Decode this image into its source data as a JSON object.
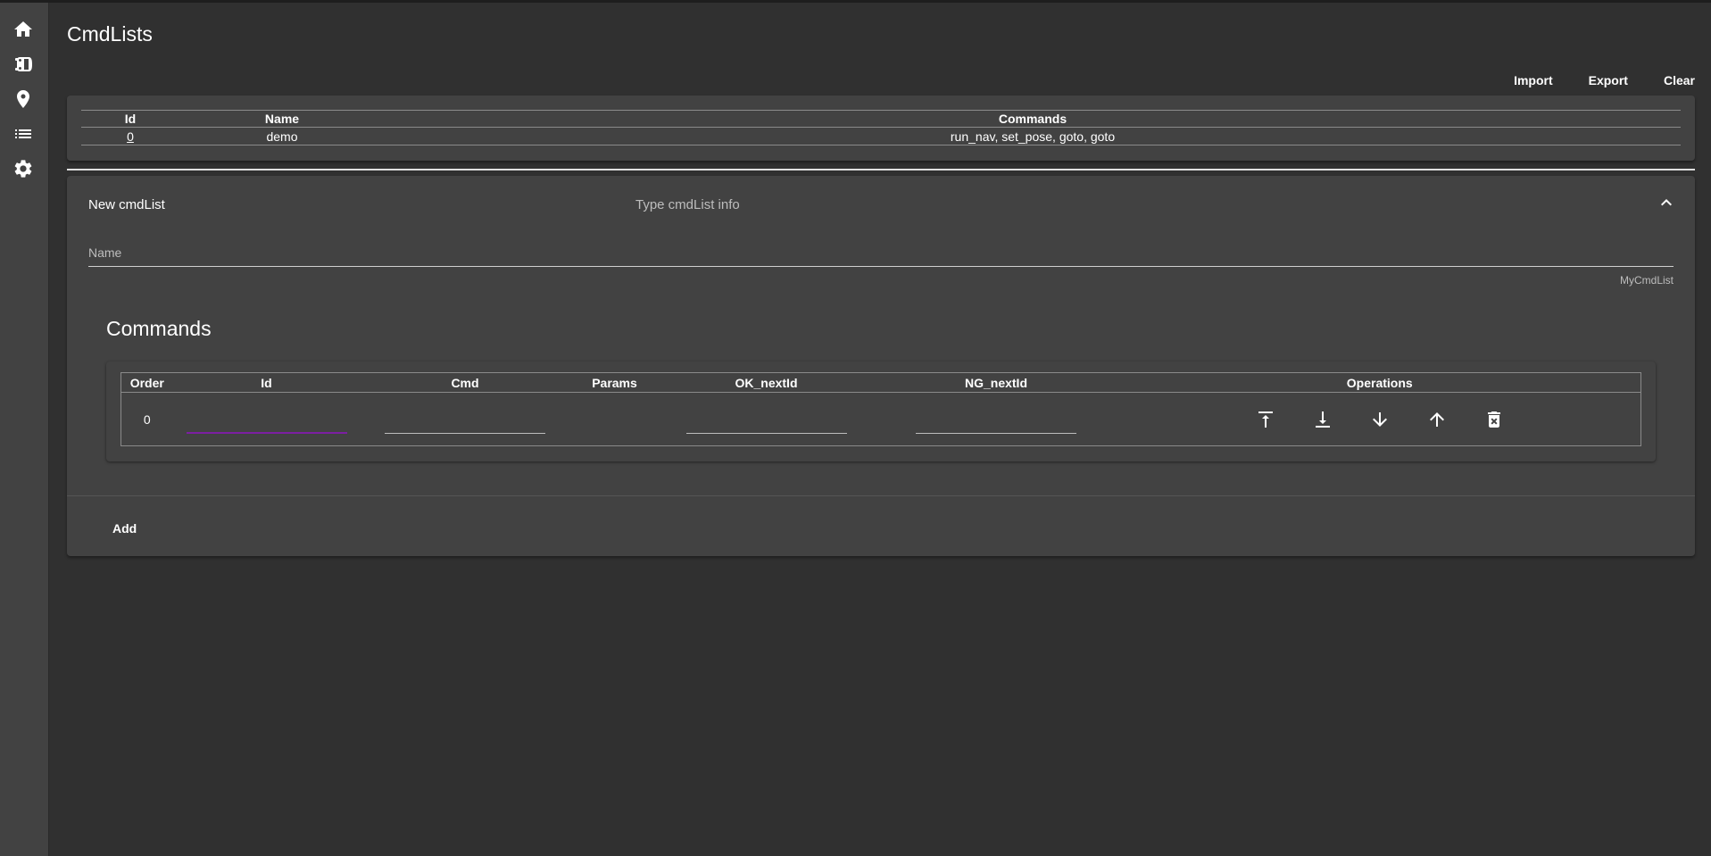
{
  "page": {
    "title": "CmdLists"
  },
  "sidebar": {
    "items": [
      {
        "name": "home",
        "icon": "home-icon"
      },
      {
        "name": "vehicles",
        "icon": "bus-icon"
      },
      {
        "name": "locations",
        "icon": "map-pin-icon"
      },
      {
        "name": "cmdlists",
        "icon": "list-icon"
      },
      {
        "name": "settings",
        "icon": "gear-icon"
      }
    ]
  },
  "toolbar": {
    "import_label": "Import",
    "export_label": "Export",
    "clear_label": "Clear"
  },
  "cmdlists_table": {
    "headers": {
      "id": "Id",
      "name": "Name",
      "commands": "Commands"
    },
    "rows": [
      {
        "id": "0",
        "name": "demo",
        "commands": "run_nav, set_pose, goto, goto"
      }
    ]
  },
  "new_cmdlist": {
    "title": "New cmdList",
    "description": "Type cmdList info",
    "name_label": "Name",
    "name_value": "",
    "name_hint": "MyCmdList",
    "commands_title": "Commands",
    "commands_table": {
      "headers": {
        "order": "Order",
        "id": "Id",
        "cmd": "Cmd",
        "params": "Params",
        "ok_nextid": "OK_nextId",
        "ng_nextid": "NG_nextId",
        "operations": "Operations"
      },
      "rows": [
        {
          "order": "0",
          "id": "",
          "cmd": "",
          "params": "",
          "ok_nextid": "",
          "ng_nextid": ""
        }
      ]
    },
    "add_label": "Add"
  },
  "colors": {
    "background": "#303030",
    "surface": "#424242",
    "focus_accent": "#7b1fa2",
    "text": "#ffffff"
  }
}
